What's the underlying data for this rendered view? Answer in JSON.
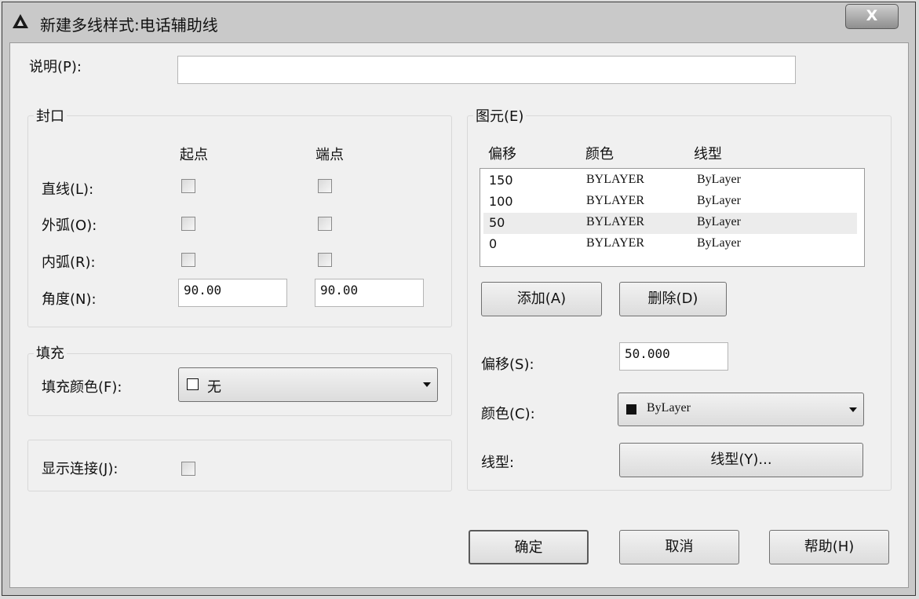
{
  "window": {
    "title": "新建多线样式:电话辅助线",
    "close_glyph": "X"
  },
  "description": {
    "label": "说明(P):",
    "value": ""
  },
  "caps": {
    "title": "封口",
    "col_start": "起点",
    "col_end": "端点",
    "line_label": "直线(L):",
    "outer_arc_label": "外弧(O):",
    "inner_arc_label": "内弧(R):",
    "angle_label": "角度(N):",
    "angle_start": "90.00",
    "angle_end": "90.00"
  },
  "fill": {
    "title": "填充",
    "color_label": "填充颜色(F):",
    "color_value": "无"
  },
  "show_joints": {
    "label": "显示连接(J):"
  },
  "elements": {
    "title": "图元(E)",
    "columns": [
      "偏移",
      "颜色",
      "线型"
    ],
    "rows": [
      {
        "offset": "150",
        "color": "BYLAYER",
        "linetype": "ByLayer"
      },
      {
        "offset": "100",
        "color": "BYLAYER",
        "linetype": "ByLayer"
      },
      {
        "offset": "50",
        "color": "BYLAYER",
        "linetype": "ByLayer"
      },
      {
        "offset": "0",
        "color": "BYLAYER",
        "linetype": "ByLayer"
      }
    ],
    "selected_row_index": 2,
    "add_label": "添加(A)",
    "delete_label": "删除(D)",
    "offset_label": "偏移(S):",
    "offset_value": "50.000",
    "color_label": "颜色(C):",
    "color_value": "ByLayer",
    "linetype_label": "线型:",
    "linetype_button": "线型(Y)..."
  },
  "footer": {
    "ok_label": "确定",
    "cancel_label": "取消",
    "help_label": "帮助(H)"
  },
  "colors": {
    "client_bg": "#f0f0f0",
    "frame_bg": "#c9c9c9",
    "selected_row": "#ececec"
  }
}
